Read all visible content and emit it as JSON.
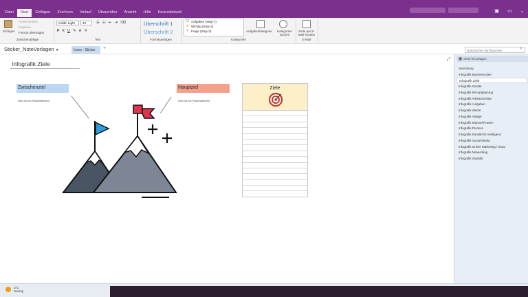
{
  "menu": {
    "items": [
      "Datei",
      "Start",
      "Einfügen",
      "Zeichnen",
      "Verlauf",
      "Überprüfen",
      "Ansicht",
      "Hilfe",
      "Kurznotizbuch"
    ],
    "active": "Start"
  },
  "ribbon": {
    "clipboard": {
      "paste": "Einfügen",
      "cut": "Ausschneiden",
      "copy": "Kopieren",
      "format_painter": "Format übertragen",
      "group": "Zwischenablage"
    },
    "text": {
      "font": "Calibri Light",
      "size": "20",
      "group": "Text"
    },
    "styles": {
      "heading1": "Überschrift 1",
      "heading2": "Überschrift 2",
      "group": "Formatvorlagen"
    },
    "tags": {
      "items": [
        {
          "label": "Aufgaben (Strg+1)",
          "mark": "☐",
          "color": "#555555"
        },
        {
          "label": "Wichtig (Strg+2)",
          "mark": "★",
          "color": "#f0a500"
        },
        {
          "label": "Frage (Strg+3)",
          "mark": "?",
          "color": "#7b4fa8"
        }
      ],
      "todo": "Aufgabenkategorie",
      "find": "Kategorien suchen",
      "group": "Kategorien"
    },
    "email": {
      "send": "Seite per E-Mail senden",
      "group": "E-Mail"
    }
  },
  "notebook": {
    "name": "Sticker_NoteVorlagen",
    "section": "Icons - Sticker",
    "search_placeholder": "Notizbücher durchsuchen"
  },
  "page": {
    "title": "Infografik Ziele",
    "intermediate_label": "Zwischenziel",
    "intermediate_text": "Dies ist ein Platzhaltertext",
    "main_label": "Hauptziel",
    "main_text": "Dies ist ein Platzhaltertext",
    "goals_title": "Ziele"
  },
  "sidebar": {
    "add_page": "Seite hinzufügen",
    "pages": [
      "Sammlung",
      "Infografik Business idee",
      "Infografik Ziele",
      "Infografik Geräte",
      "Infografik Rezeptplanung",
      "Infografik Arbeitsschritte",
      "Infografik Aufgaben",
      "Infografik Wetter",
      "Infografik Ablage",
      "Infografik Männer/Frauen",
      "Infografik Prozess",
      "Infografik Künstliche Intelligenz",
      "Infografik Social Media",
      "Infografik Online Marketing / Shop",
      "Infografik Networking",
      "Infografik Statistik"
    ],
    "active_index": 2
  },
  "status": {
    "temperature": "3°C",
    "condition": "Sonnig"
  },
  "colors": {
    "title_bar": "#7b2f8e",
    "intermediate_label_bg": "#bcd7f2",
    "main_label_bg": "#f3a08d",
    "goal_header_bg": "#fdf0c8",
    "flag_blue": "#2d9be0",
    "flag_red": "#e0354f"
  }
}
